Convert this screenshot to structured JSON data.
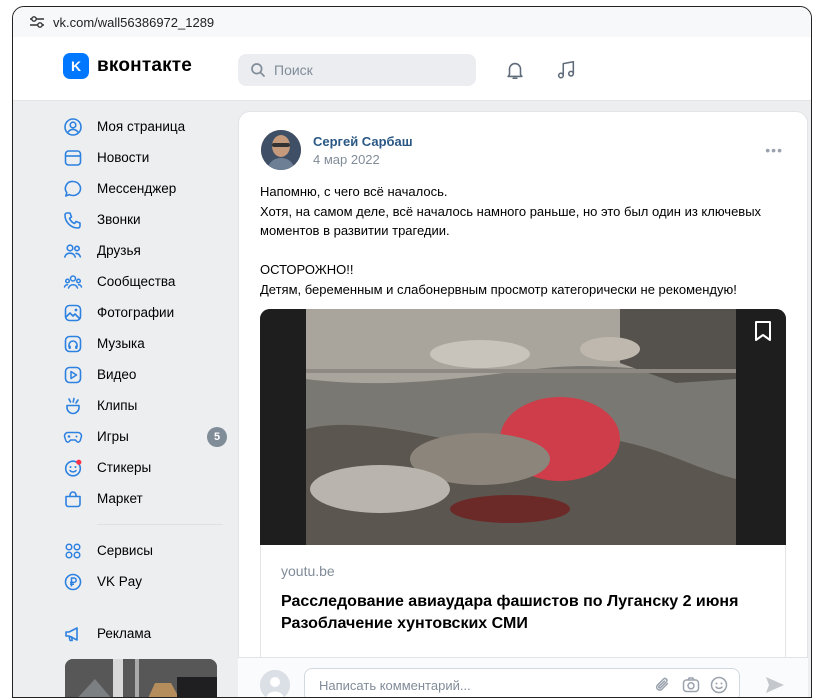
{
  "browser": {
    "url": "vk.com/wall56386972_1289"
  },
  "header": {
    "logo_text": "вконтакте",
    "logo_mark": "K",
    "search_placeholder": "Поиск",
    "icons": [
      "bell-icon",
      "music-icon"
    ]
  },
  "sidebar": {
    "items": [
      {
        "label": "Моя страница",
        "icon": "profile-icon"
      },
      {
        "label": "Новости",
        "icon": "news-icon"
      },
      {
        "label": "Мессенджер",
        "icon": "messenger-icon"
      },
      {
        "label": "Звонки",
        "icon": "phone-icon"
      },
      {
        "label": "Друзья",
        "icon": "friends-icon"
      },
      {
        "label": "Сообщества",
        "icon": "communities-icon"
      },
      {
        "label": "Фотографии",
        "icon": "photos-icon"
      },
      {
        "label": "Музыка",
        "icon": "music-icon"
      },
      {
        "label": "Видео",
        "icon": "video-icon"
      },
      {
        "label": "Клипы",
        "icon": "clips-icon"
      },
      {
        "label": "Игры",
        "icon": "games-icon",
        "badge": "5"
      },
      {
        "label": "Стикеры",
        "icon": "stickers-icon"
      },
      {
        "label": "Маркет",
        "icon": "market-icon"
      }
    ],
    "items2": [
      {
        "label": "Сервисы",
        "icon": "services-icon"
      },
      {
        "label": "VK Pay",
        "icon": "vkpay-icon"
      }
    ],
    "items3": [
      {
        "label": "Реклама",
        "icon": "ads-icon"
      }
    ]
  },
  "post": {
    "author": "Сергей Сарбаш",
    "date": "4 мар 2022",
    "more": "•••",
    "text_lines": [
      "Напомню, с чего всё началось.",
      "Хотя, на самом деле, всё началось намного раньше, но это был один из ключевых моментов в развитии трагедии.",
      "ОСТОРОЖНО!!",
      "Детям, беременным и слабонервным просмотр категорически не рекомендую!"
    ],
    "link": {
      "domain": "youtu.be",
      "title": "Расследование авиаудара фашистов по Луганску 2 июня Разоблачение хунтовских СМИ"
    }
  },
  "comment": {
    "placeholder": "Написать комментарий..."
  },
  "colors": {
    "accent": "#0077ff",
    "link": "#2a5885",
    "muted": "#818c99",
    "background": "#edeef0"
  }
}
